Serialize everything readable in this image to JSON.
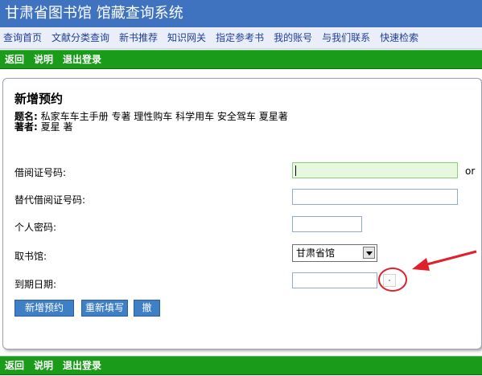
{
  "header": {
    "title": "甘肃省图书馆 馆藏查询系统"
  },
  "nav": {
    "items": [
      "查询首页",
      "文献分类查询",
      "新书推荐",
      "知识网关",
      "指定参考书",
      "我的账号",
      "与我们联系",
      "快速检索"
    ]
  },
  "actionbar": {
    "back": "返回",
    "help": "说明",
    "logout": "退出登录"
  },
  "form": {
    "heading": "新增预约",
    "title_label": "题名:",
    "title_value": "私家车车主手册 专著 理性购车 科学用车 安全驾车 夏星著",
    "author_label": "著者:",
    "author_value": "夏星 著",
    "card_label": "借阅证号码:",
    "card_or": "or",
    "alt_card_label": "替代借阅证号码:",
    "pin_label": "个人密码:",
    "pickup_label": "取书馆:",
    "pickup_value": "甘肃省馆",
    "expiry_label": "到期日期:",
    "submit": "新增预约",
    "reset": "重新填写",
    "cancel": "撤销"
  },
  "colors": {
    "header": "#3f72bf",
    "actionbar": "#1a9b1a",
    "annotation": "#e0202a"
  }
}
